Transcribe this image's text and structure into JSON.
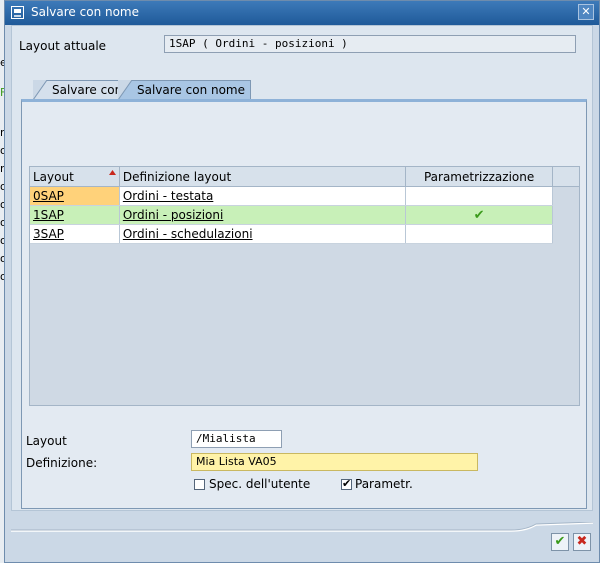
{
  "background_letters": [
    "e",
    "F",
    "r",
    "o",
    "r",
    "o",
    "o",
    "o",
    "o",
    "o",
    "o"
  ],
  "dialog": {
    "title": "Salvare con nome",
    "close_glyph": "✕"
  },
  "current_layout": {
    "label": "Layout attuale",
    "value": "1SAP ( Ordini - posizioni )"
  },
  "tabs": [
    {
      "label": "Salvare con",
      "active": false
    },
    {
      "label": "Salvare con nome",
      "active": true
    }
  ],
  "table": {
    "columns": [
      "Layout",
      "Definizione layout",
      "Parametrizzazione"
    ],
    "rows": [
      {
        "layout": "0SAP",
        "definition": "Ordini - testata",
        "param": ""
      },
      {
        "layout": "1SAP",
        "definition": "Ordini - posizioni",
        "param": "✔"
      },
      {
        "layout": "3SAP",
        "definition": "Ordini - schedulazioni",
        "param": ""
      }
    ]
  },
  "form": {
    "layout_label": "Layout",
    "layout_value": "/Mialista",
    "definition_label": "Definizione:",
    "definition_value": "Mia Lista VA05",
    "user_spec_label": "Spec. dell'utente",
    "user_spec_checked": false,
    "param_label": "Parametr.",
    "param_checked": true
  },
  "buttons": {
    "ok_glyph": "✔",
    "cancel_glyph": "✖"
  },
  "colors": {
    "title_bar": "#1f5a99",
    "selected_row": "#c8f0b8",
    "required_field": "#fff3a8",
    "ok_green": "#3a9a1a",
    "cancel_red": "#c8281e"
  }
}
